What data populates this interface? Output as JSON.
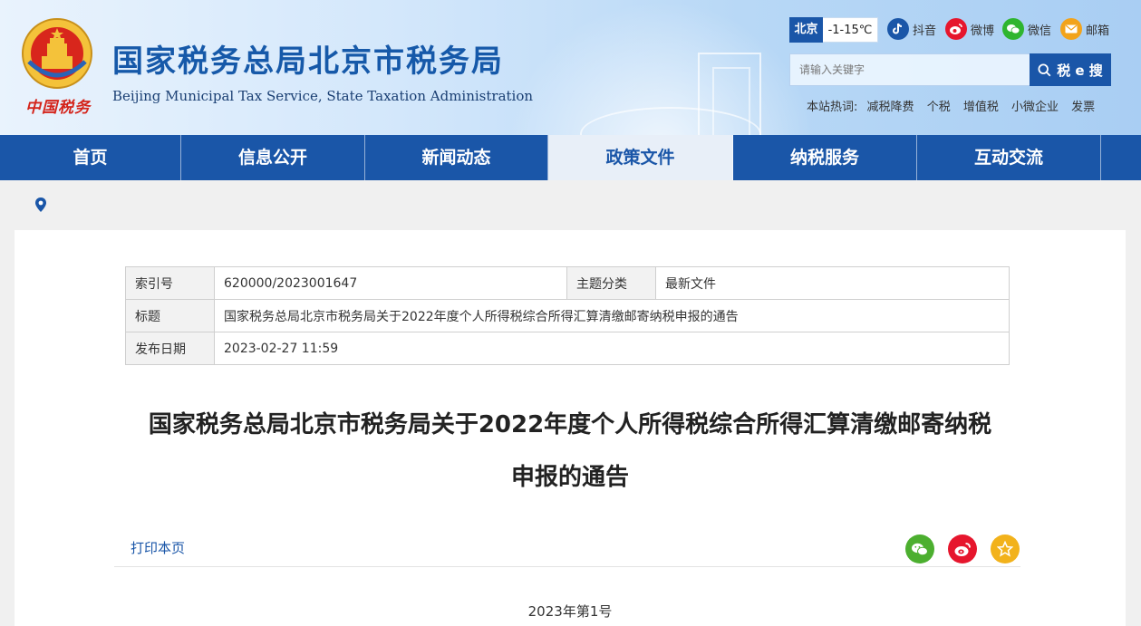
{
  "header": {
    "title_cn": "国家税务总局北京市税务局",
    "title_en": "Beijing Municipal Tax Service, State Taxation Administration",
    "china_tax": "中国税务",
    "weather": {
      "city": "北京",
      "temp": "-1-15℃"
    },
    "social": [
      {
        "name": "douyin",
        "label": "抖音",
        "color": "#1a56a8"
      },
      {
        "name": "weibo",
        "label": "微博",
        "color": "#e6162d"
      },
      {
        "name": "wechat",
        "label": "微信",
        "color": "#2fb52f"
      },
      {
        "name": "mail",
        "label": "邮箱",
        "color": "#f2a31b"
      }
    ],
    "search": {
      "placeholder": "请输入关键字",
      "button": "税 e 搜"
    },
    "hot": {
      "label": "本站热词:",
      "words": [
        "减税降费",
        "个税",
        "增值税",
        "小微企业",
        "发票"
      ]
    }
  },
  "nav": {
    "items": [
      "首页",
      "信息公开",
      "新闻动态",
      "政策文件",
      "纳税服务",
      "互动交流"
    ],
    "active_index": 3
  },
  "meta": {
    "index_label": "索引号",
    "index_value": "620000/2023001647",
    "category_label": "主题分类",
    "category_value": "最新文件",
    "title_label": "标题",
    "title_value": "国家税务总局北京市税务局关于2022年度个人所得税综合所得汇算清缴邮寄纳税申报的通告",
    "date_label": "发布日期",
    "date_value": "2023-02-27 11:59"
  },
  "article": {
    "title_line1": "国家税务总局北京市税务局关于2022年度个人所得税综合所得汇算清缴邮寄纳税",
    "title_line2": "申报的通告",
    "print": "打印本页",
    "doc_no": "2023年第1号"
  },
  "colors": {
    "brand": "#1a56a8",
    "wechat": "#4caf2f",
    "weibo": "#e6162d",
    "favorite": "#f2b21b"
  }
}
